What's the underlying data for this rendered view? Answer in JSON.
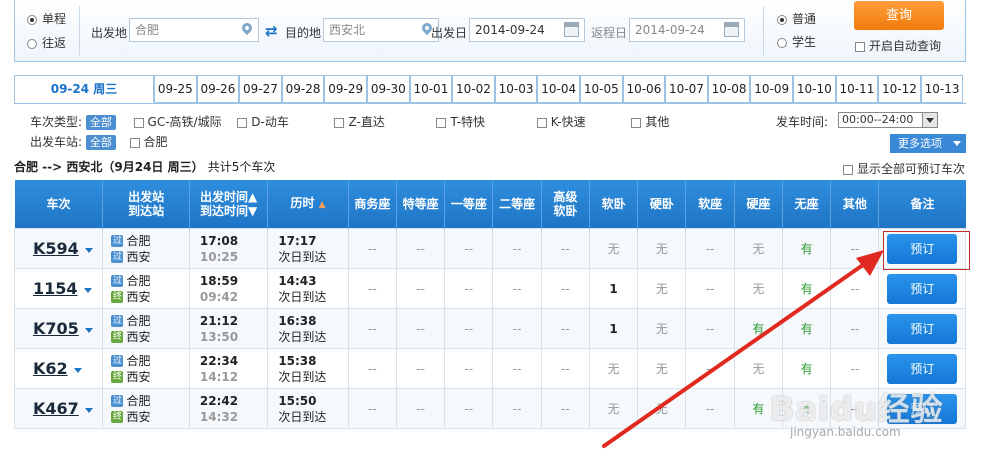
{
  "search": {
    "trip_single": "单程",
    "trip_round": "往返",
    "from_label": "出发地",
    "from_value": "合肥",
    "to_label": "目的地",
    "to_value": "西安北",
    "depart_label": "出发日",
    "depart_value": "2014-09-24",
    "return_label": "返程日",
    "return_value": "2014-09-24",
    "type_normal": "普通",
    "type_student": "学生",
    "query_button": "查询",
    "auto_query": "开启自动查询"
  },
  "date_tabs": [
    "09-24 周三",
    "09-25",
    "09-26",
    "09-27",
    "09-28",
    "09-29",
    "09-30",
    "10-01",
    "10-02",
    "10-03",
    "10-04",
    "10-05",
    "10-06",
    "10-07",
    "10-08",
    "10-09",
    "10-10",
    "10-11",
    "10-12",
    "10-13"
  ],
  "filters": {
    "type_label": "车次类型:",
    "all_label": "全部",
    "types": [
      "GC-高铁/城际",
      "D-动车",
      "Z-直达",
      "T-特快",
      "K-快速",
      "其他"
    ],
    "station_label": "出发车站:",
    "stations": [
      "合肥"
    ],
    "time_label": "发车时间:",
    "time_value": "00:00--24:00",
    "more_button": "更多选项"
  },
  "summary": {
    "route": "合肥 --> 西安北（9月24日 周三）",
    "count": "共计5个车次",
    "show_all": "显示全部可预订车次"
  },
  "table": {
    "headers": {
      "train": "车次",
      "station_top": "出发站",
      "station_bottom": "到达站",
      "time_top": "出发时间▲",
      "time_bottom": "到达时间▼",
      "duration": "历时",
      "business": "商务座",
      "special": "特等座",
      "first": "一等座",
      "second": "二等座",
      "gaoji_top": "高级",
      "gaoji_bottom": "软卧",
      "soft_sleeper": "软卧",
      "hard_sleeper": "硬卧",
      "soft_seat": "软座",
      "hard_seat": "硬座",
      "no_seat": "无座",
      "other": "其他",
      "remark": "备注"
    },
    "rows": [
      {
        "train": "K594",
        "from_badge": "过",
        "from": "合肥",
        "to_badge": "过",
        "to": "西安",
        "depart": "17:08",
        "arrive": "10:25",
        "duration": "17:17",
        "next_day": "次日到达",
        "seats": [
          "--",
          "--",
          "--",
          "--",
          "--",
          "无",
          "无",
          "--",
          "无",
          "有",
          "--"
        ],
        "book": "预订"
      },
      {
        "train": "1154",
        "from_badge": "过",
        "from": "合肥",
        "to_badge": "终",
        "to": "西安",
        "depart": "18:59",
        "arrive": "09:42",
        "duration": "14:43",
        "next_day": "次日到达",
        "seats": [
          "--",
          "--",
          "--",
          "--",
          "--",
          "1",
          "无",
          "--",
          "无",
          "有",
          "--"
        ],
        "book": "预订"
      },
      {
        "train": "K705",
        "from_badge": "过",
        "from": "合肥",
        "to_badge": "终",
        "to": "西安",
        "depart": "21:12",
        "arrive": "13:50",
        "duration": "16:38",
        "next_day": "次日到达",
        "seats": [
          "--",
          "--",
          "--",
          "--",
          "--",
          "1",
          "无",
          "--",
          "有",
          "有",
          "--"
        ],
        "book": "预订"
      },
      {
        "train": "K62",
        "from_badge": "过",
        "from": "合肥",
        "to_badge": "终",
        "to": "西安",
        "depart": "22:34",
        "arrive": "14:12",
        "duration": "15:38",
        "next_day": "次日到达",
        "seats": [
          "--",
          "--",
          "--",
          "--",
          "--",
          "无",
          "无",
          "--",
          "无",
          "有",
          "--"
        ],
        "book": "预订"
      },
      {
        "train": "K467",
        "from_badge": "过",
        "from": "合肥",
        "to_badge": "终",
        "to": "西安",
        "depart": "22:42",
        "arrive": "14:32",
        "duration": "15:50",
        "next_day": "次日到达",
        "seats": [
          "--",
          "--",
          "--",
          "--",
          "--",
          "无",
          "无",
          "--",
          "有",
          "4",
          "--"
        ],
        "book": "预订"
      }
    ]
  },
  "watermark": {
    "logo": "Baidu经验",
    "url": "jingyan.baidu.com"
  },
  "colors": {
    "header_blue": "#1f74c4",
    "accent_orange": "#f07c0c",
    "book_blue": "#1477d6",
    "have_green": "#2e9a2e",
    "highlight_red": "#c0302b"
  }
}
